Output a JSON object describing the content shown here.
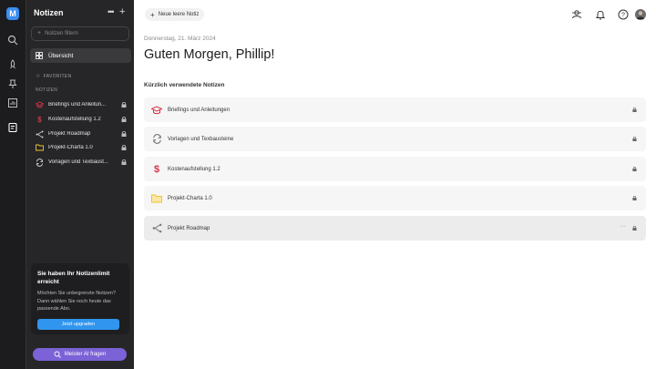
{
  "rail": {
    "logo_letter": "M",
    "icons": [
      "search-icon",
      "rocket-icon",
      "pin-icon",
      "chart-icon",
      "notes-icon"
    ]
  },
  "sidebar": {
    "title": "Notizen",
    "filter_placeholder": "Notizen filtern",
    "overview_label": "Übersicht",
    "favorites_label": "FAVORITEN",
    "notes_label": "NOTIZEN",
    "items": [
      {
        "label": "Briefings und Anleitun...",
        "icon": "graduation-cap-icon",
        "color": "#d9334b"
      },
      {
        "label": "Kostenaufstellung 1.2",
        "icon": "dollar-icon",
        "color": "#d9334b"
      },
      {
        "label": "Projekt Roadmap",
        "icon": "flow-icon",
        "color": "#cccccc"
      },
      {
        "label": "Projekt-Charta 1.0",
        "icon": "folder-icon",
        "color": "#f2c230"
      },
      {
        "label": "Vorlagen und Texbaust...",
        "icon": "sync-icon",
        "color": "#cccccc"
      }
    ],
    "limit_card": {
      "title": "Sie haben Ihr Notizenlimit erreicht",
      "text": "Möchten Sie unbegrenzte Notizen? Dann wählen Sie noch heute das passende Abo.",
      "button": "Jetzt upgraden"
    },
    "ai_button": "Meister AI fragen"
  },
  "main": {
    "new_note_label": "Neue leere Notiz",
    "date": "Donnerstag, 21. März 2024",
    "greeting": "Guten Morgen, Phillip!",
    "recent_heading": "Kürzlich verwendete Notizen",
    "recent": [
      {
        "label": "Briefings und Anleitungen",
        "icon": "graduation-cap-icon"
      },
      {
        "label": "Vorlagen und Texbausteine",
        "icon": "sync-icon"
      },
      {
        "label": "Kostenaufstellung 1.2",
        "icon": "dollar-icon"
      },
      {
        "label": "Projekt-Charta 1.0",
        "icon": "folder-icon"
      },
      {
        "label": "Projekt Roadmap",
        "icon": "flow-icon"
      }
    ]
  },
  "colors": {
    "accent_blue": "#2f95ee",
    "ai_purple": "#7b62d6",
    "red_icon": "#d9334b",
    "folder_yellow": "#f2c230"
  }
}
